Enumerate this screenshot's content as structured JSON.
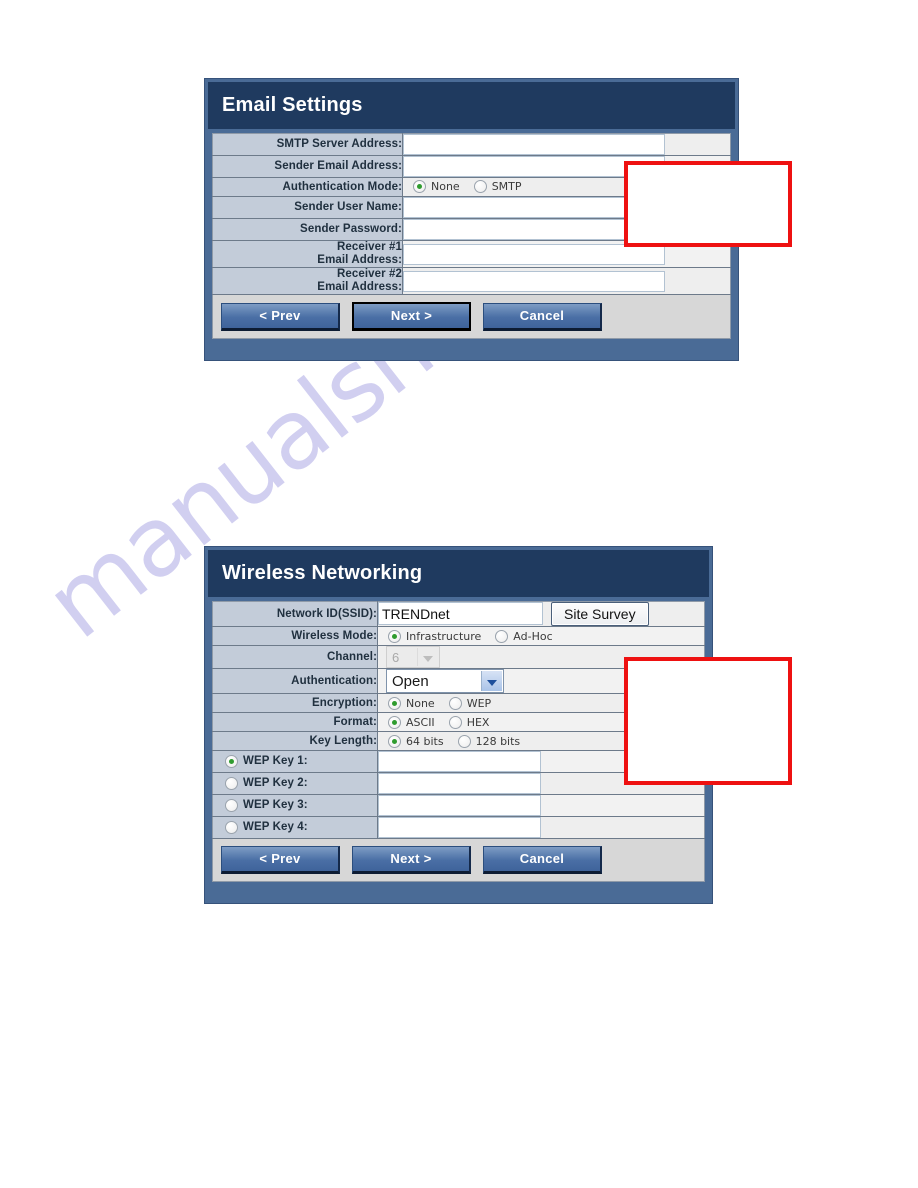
{
  "watermark": {
    "text": "manualshive.com",
    "color": "#c9c7ee"
  },
  "theme": {
    "header_bg": "#1f3a5f",
    "panel_border": "#4a6b96",
    "label_bg": "#c3ccd9",
    "field_bg": "#eeeeee",
    "footer_bg": "#d7d7d7",
    "button_blue": "#4a6fa5",
    "radio_dot": "#2f9c2f",
    "annotation_red": "#ee1111"
  },
  "email_panel": {
    "title": "Email Settings",
    "rows": [
      {
        "label": "SMTP Server Address:",
        "type": "text",
        "value": "",
        "name": "smtp-server-address"
      },
      {
        "label": "Sender Email Address:",
        "type": "text",
        "value": "",
        "name": "sender-email-address"
      },
      {
        "label": "Authentication Mode:",
        "type": "radio",
        "name": "authentication-mode",
        "options": [
          {
            "label": "None",
            "selected": true
          },
          {
            "label": "SMTP",
            "selected": false
          }
        ]
      },
      {
        "label": "Sender User Name:",
        "type": "text",
        "value": "",
        "name": "sender-user-name"
      },
      {
        "label": "Sender Password:",
        "type": "text",
        "value": "",
        "name": "sender-password"
      },
      {
        "label": "Receiver #1\nEmail Address:",
        "label_line1": "Receiver #1",
        "label_line2": "Email Address:",
        "type": "text",
        "value": "",
        "name": "receiver-1-email-address"
      },
      {
        "label": "Receiver #2\nEmail Address:",
        "label_line1": "Receiver #2",
        "label_line2": "Email Address:",
        "type": "text",
        "value": "",
        "name": "receiver-2-email-address"
      }
    ],
    "buttons": [
      {
        "label": "< Prev",
        "name": "prev-button",
        "focused": false
      },
      {
        "label": "Next >",
        "name": "next-button",
        "focused": true
      },
      {
        "label": "Cancel",
        "name": "cancel-button",
        "focused": false
      }
    ]
  },
  "wireless_panel": {
    "title": "Wireless Networking",
    "ssid": {
      "label": "Network ID(SSID):",
      "value": "TRENDnet",
      "button_label": "Site Survey"
    },
    "wireless_mode": {
      "label": "Wireless Mode:",
      "options": [
        {
          "label": "Infrastructure",
          "selected": true
        },
        {
          "label": "Ad-Hoc",
          "selected": false
        }
      ]
    },
    "channel": {
      "label": "Channel:",
      "value": "6",
      "disabled": true
    },
    "authentication": {
      "label": "Authentication:",
      "value": "Open",
      "disabled": false
    },
    "encryption": {
      "label": "Encryption:",
      "options": [
        {
          "label": "None",
          "selected": true
        },
        {
          "label": "WEP",
          "selected": false
        }
      ]
    },
    "format": {
      "label": "Format:",
      "options": [
        {
          "label": "ASCII",
          "selected": true
        },
        {
          "label": "HEX",
          "selected": false
        }
      ]
    },
    "key_length": {
      "label": "Key Length:",
      "options": [
        {
          "label": "64 bits",
          "selected": true
        },
        {
          "label": "128 bits",
          "selected": false
        }
      ]
    },
    "wep_keys": [
      {
        "label": "WEP Key 1:",
        "selected": true,
        "value": ""
      },
      {
        "label": "WEP Key 2:",
        "selected": false,
        "value": ""
      },
      {
        "label": "WEP Key 3:",
        "selected": false,
        "value": ""
      },
      {
        "label": "WEP Key 4:",
        "selected": false,
        "value": ""
      }
    ],
    "buttons": [
      {
        "label": "< Prev",
        "name": "prev-button",
        "focused": false
      },
      {
        "label": "Next >",
        "name": "next-button",
        "focused": false
      },
      {
        "label": "Cancel",
        "name": "cancel-button",
        "focused": false
      }
    ]
  },
  "annotations": [
    {
      "name": "callout-box-email",
      "text": ""
    },
    {
      "name": "callout-box-wireless",
      "text": ""
    }
  ]
}
